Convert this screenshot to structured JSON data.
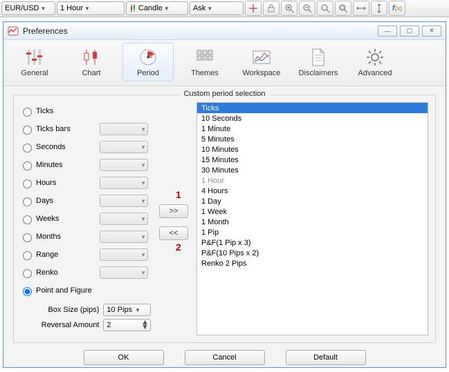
{
  "toolbar": {
    "symbol": "EUR/USD",
    "timeframe": "1 Hour",
    "chart_type": "Candle",
    "price_side": "Ask"
  },
  "window": {
    "title": "Preferences"
  },
  "tabs": {
    "items": [
      {
        "label": "General"
      },
      {
        "label": "Chart"
      },
      {
        "label": "Period"
      },
      {
        "label": "Themes"
      },
      {
        "label": "Workspace"
      },
      {
        "label": "Disclaimers"
      },
      {
        "label": "Advanced"
      }
    ],
    "active_index": 2
  },
  "period": {
    "legend": "Custom period selection",
    "radios": [
      {
        "label": "Ticks",
        "has_combo": false
      },
      {
        "label": "Ticks bars",
        "has_combo": true
      },
      {
        "label": "Seconds",
        "has_combo": true
      },
      {
        "label": "Minutes",
        "has_combo": true
      },
      {
        "label": "Hours",
        "has_combo": true
      },
      {
        "label": "Days",
        "has_combo": true
      },
      {
        "label": "Weeks",
        "has_combo": true
      },
      {
        "label": "Months",
        "has_combo": true
      },
      {
        "label": "Range",
        "has_combo": true
      },
      {
        "label": "Renko",
        "has_combo": true
      }
    ],
    "selected_radio": "Point and Figure",
    "pnf": {
      "box_label": "Box Size (pips)",
      "box_value": "10 Pips",
      "rev_label": "Reversal Amount",
      "rev_value": "2"
    },
    "move_add": ">>",
    "move_remove": "<<",
    "anno1": "1",
    "anno2": "2",
    "list": [
      {
        "label": "Ticks",
        "selected": true
      },
      {
        "label": "10 Seconds"
      },
      {
        "label": "1 Minute"
      },
      {
        "label": "5 Minutes"
      },
      {
        "label": "10 Minutes"
      },
      {
        "label": "15 Minutes"
      },
      {
        "label": "30 Minutes"
      },
      {
        "label": "1 Hour",
        "dim": true
      },
      {
        "label": "4 Hours"
      },
      {
        "label": "1 Day"
      },
      {
        "label": "1 Week"
      },
      {
        "label": "1 Month"
      },
      {
        "label": "1 Pip"
      },
      {
        "label": "P&F(1 Pip x 3)"
      },
      {
        "label": "P&F(10 Pips x 2)"
      },
      {
        "label": "Renko 2 Pips"
      }
    ]
  },
  "dialog": {
    "ok": "OK",
    "cancel": "Cancel",
    "default": "Default"
  }
}
